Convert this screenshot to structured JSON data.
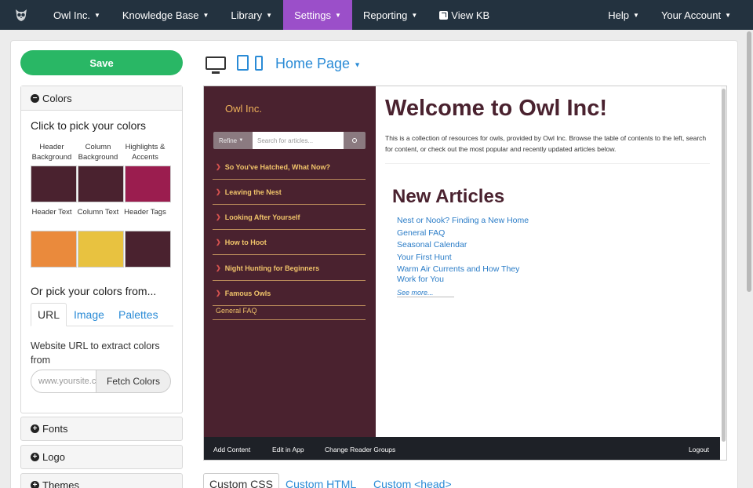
{
  "nav": {
    "items": [
      {
        "label": "Owl Inc.",
        "caret": "▼"
      },
      {
        "label": "Knowledge Base",
        "caret": "▼"
      },
      {
        "label": "Library",
        "caret": "▼"
      },
      {
        "label": "Settings",
        "caret": "▼"
      },
      {
        "label": "Reporting",
        "caret": "▼"
      }
    ],
    "view_kb": "View KB",
    "help": "Help",
    "account": "Your Account",
    "active_color": "#9b4fc9",
    "bg_color": "#23323f"
  },
  "left": {
    "save": "Save",
    "colors_header": "Colors",
    "pick_title": "Click to pick your colors",
    "swatch_labels": [
      "Header Background",
      "Column Background",
      "Highlights & Accents",
      "Header Text",
      "Column Text",
      "Header Tags"
    ],
    "swatch_colors": [
      "#4a222f",
      "#4a222f",
      "#9b1d4f",
      "#ea8a3c",
      "#e8c240",
      "#4a222f"
    ],
    "or_title": "Or pick your colors from...",
    "tabs": [
      "URL",
      "Image",
      "Palettes"
    ],
    "url_label": "Website URL to extract colors from",
    "url_placeholder": "www.yoursite.com",
    "fetch": "Fetch Colors",
    "fonts": "Fonts",
    "logo": "Logo",
    "themes": "Themes"
  },
  "toolbar": {
    "page": "Home Page",
    "caret": "▼"
  },
  "preview": {
    "brand": "Owl Inc.",
    "refine": "Refine",
    "refine_caret": "▼",
    "search_placeholder": "Search for articles...",
    "nav_chev": "❯",
    "nav": [
      "So You've Hatched, What Now?",
      "Leaving the Nest",
      "Looking After Yourself",
      "How to Hoot",
      "Night Hunting for Beginners",
      "Famous Owls"
    ],
    "plain_link": "General FAQ",
    "title": "Welcome to Owl Inc!",
    "description": "This is a collection of resources for owls, provided by Owl Inc. Browse the table of contents to the left, search for content, or check out the most popular and recently updated articles below.",
    "new_articles": "New Articles",
    "articles": [
      "Nest or Nook? Finding a New Home",
      "General FAQ",
      "Seasonal Calendar",
      "Your First Hunt",
      "Warm Air Currents and How They Work for You"
    ],
    "see_more": "See more...",
    "footer": {
      "add": "Add Content",
      "edit": "Edit in App",
      "groups": "Change Reader Groups",
      "logout": "Logout"
    }
  },
  "bottom_tabs": [
    "Custom CSS",
    "Custom HTML",
    "Custom <head>"
  ]
}
